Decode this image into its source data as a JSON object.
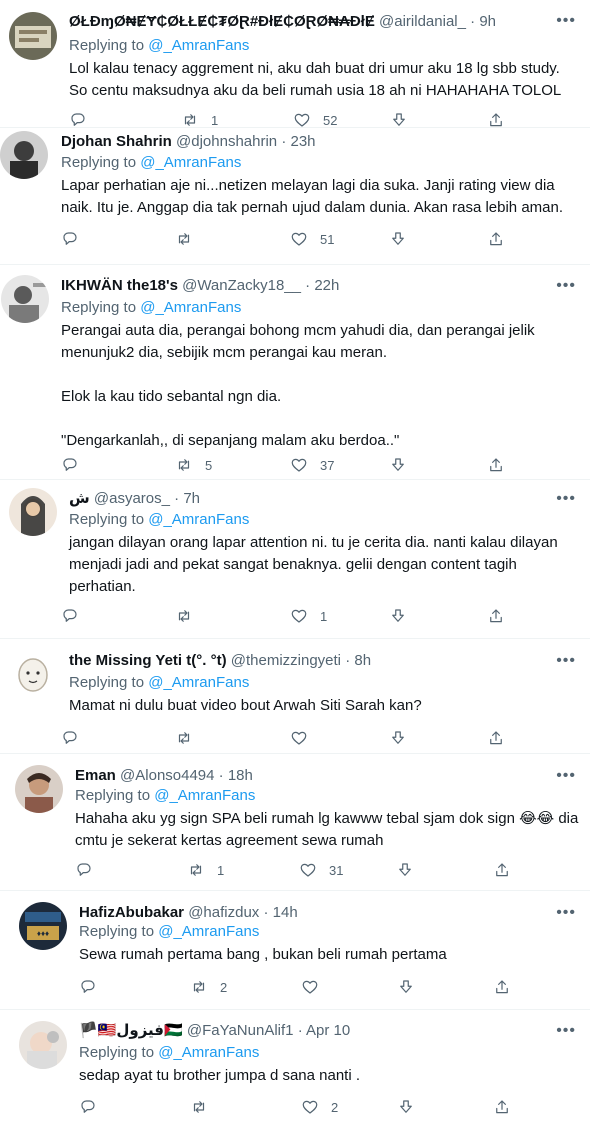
{
  "reply_prefix": "Replying to",
  "tweets": [
    {
      "name": "ØŁĐɱØ₦ɆɎ₵ØŁŁɆ₵₮ØⱤ#ĐłɆ₵ØⱤØ₦₳ĐłɆ",
      "handle": "@airildanial_",
      "time": "9h",
      "replying_to": "@_AmranFans",
      "body": "Lol kalau tenacy aggrement ni, aku dah buat dri umur aku 18 lg sbb study.\nSo centu maksudnya aku da beli rumah usia 18 ah ni HAHAHAHA TOLOL",
      "retweets": "1",
      "likes": "52"
    },
    {
      "name": "Djohan Shahrin",
      "handle": "@djohnshahrin",
      "time": "23h",
      "replying_to": "@_AmranFans",
      "body": "Lapar perhatian aje ni...netizen melayan lagi dia suka. Janji rating view dia\nnaik. Itu je. Anggap dia tak pernah ujud dalam dunia. Akan rasa lebih aman.",
      "retweets": "",
      "likes": "51"
    },
    {
      "name": "IKHWÄN the18's",
      "handle": "@WanZacky18__",
      "time": "22h",
      "replying_to": "@_AmranFans",
      "body": "Perangai auta dia, perangai bohong mcm yahudi dia, dan perangai jelik\nmenunjuk2 dia, sebijik mcm perangai kau meran.\n\nElok la kau tido sebantal ngn dia.\n\n\"Dengarkanlah,, di sepanjang malam aku berdoa..\"",
      "retweets": "5",
      "likes": "37"
    },
    {
      "name": "ش",
      "handle": "@asyaros_",
      "time": "7h",
      "replying_to": "@_AmranFans",
      "body": "jangan dilayan orang lapar attention ni. tu je cerita dia. nanti kalau dilayan\nmenjadi jadi and pekat sangat benaknya. gelii dengan content tagih\nperhatian.",
      "retweets": "",
      "likes": "1"
    },
    {
      "name": "the Missing Yeti t(°. °t)",
      "handle": "@themizzingyeti",
      "time": "8h",
      "replying_to": "@_AmranFans",
      "body": "Mamat ni dulu buat video bout Arwah Siti Sarah kan?",
      "retweets": "",
      "likes": ""
    },
    {
      "name": "Eman",
      "handle": "@Alonso4494",
      "time": "18h",
      "replying_to": "@_AmranFans",
      "body": "Hahaha aku yg sign SPA beli rumah lg kawww tebal sjam dok sign 😂😂 dia\ncmtu je sekerat kertas agreement sewa rumah",
      "retweets": "1",
      "likes": "31"
    },
    {
      "name": "HafizAbubakar",
      "handle": "@hafizdux",
      "time": "14h",
      "replying_to": "@_AmranFans",
      "body": "Sewa rumah pertama bang , bukan beli rumah pertama",
      "retweets": "2",
      "likes": ""
    },
    {
      "name": "🏴🇲🇾فيزول🇵🇸",
      "handle": "@FaYaNunAlif1",
      "time": "Apr 10",
      "replying_to": "@_AmranFans",
      "body": "sedap ayat tu brother jumpa d sana nanti .",
      "retweets": "",
      "likes": "2"
    }
  ],
  "icons": {
    "reply": "reply-icon",
    "retweet": "retweet-icon",
    "like": "like-icon",
    "share": "share-icon",
    "more": "more-icon"
  },
  "colors": {
    "text": "#0f1419",
    "muted": "#536471",
    "link": "#1d9bf0",
    "divider": "#eff3f4"
  }
}
